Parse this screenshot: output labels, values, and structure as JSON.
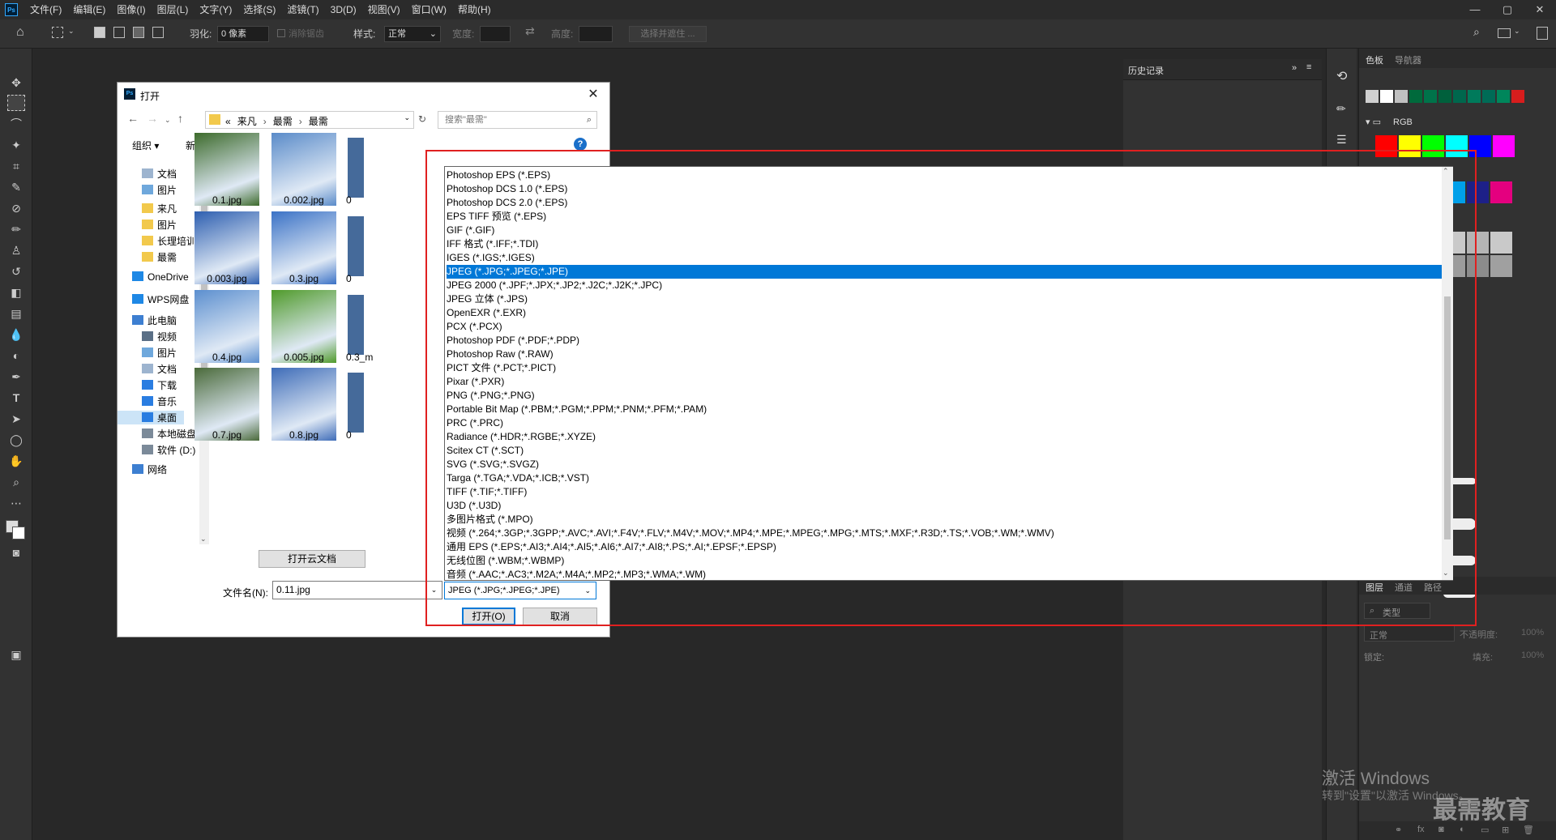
{
  "menubar": {
    "app_icon": "Ps",
    "items": [
      "文件(F)",
      "编辑(E)",
      "图像(I)",
      "图层(L)",
      "文字(Y)",
      "选择(S)",
      "滤镜(T)",
      "3D(D)",
      "视图(V)",
      "窗口(W)",
      "帮助(H)"
    ],
    "window_controls": [
      "—",
      "▢",
      "✕"
    ]
  },
  "options": {
    "feather_label": "羽化:",
    "feather_value": "0 像素",
    "antialias_label": "消除锯齿",
    "style_label": "样式:",
    "style_value": "正常",
    "width_label": "宽度:",
    "height_label": "高度:",
    "select_mask_label": "选择并遮住 ..."
  },
  "history_panel": {
    "title": "历史记录"
  },
  "swatches_panel": {
    "tabs": [
      "色板",
      "导航器"
    ],
    "group_label": "RGB",
    "recent_colors": [
      "#d0d0d0",
      "#ffffff",
      "#c0c0c0",
      "#006a3c",
      "#00734a",
      "#00603c",
      "#00674d",
      "#007a5b",
      "#006b56",
      "#00865b",
      "#d71d1d"
    ],
    "rgb_colors": [
      "#ff0000",
      "#ffff00",
      "#00ff00",
      "#00ffff",
      "#0000ff",
      "#ff00ff"
    ],
    "row2_colors": [
      "#00a0e9",
      "#1d2088",
      "#e4007f"
    ],
    "gray_colors": [
      "#c9c9c9",
      "#b5b5b5",
      "#c9c9c9",
      "#9c9c9c",
      "#8c8c8c",
      "#a0a0a0"
    ]
  },
  "layers_panel": {
    "tabs": [
      "图层",
      "通道",
      "路径"
    ],
    "kind_label": "类型",
    "blend_mode": "正常",
    "opacity_label": "不透明度:",
    "opacity_value": "100%",
    "lock_label": "锁定:",
    "fill_label": "填充:",
    "fill_value": "100%"
  },
  "dialog": {
    "title": "打开",
    "path": [
      "«",
      "来凡",
      "最需",
      "最需"
    ],
    "search_placeholder": "搜索\"最需\"",
    "organize": "组织 ▾",
    "new_folder": "新建文件夹",
    "nav_items": [
      {
        "label": "文档",
        "icon": "document-icon"
      },
      {
        "label": "图片",
        "icon": "picture-icon"
      },
      {
        "label": "来凡",
        "icon": "folder-icon"
      },
      {
        "label": "图片",
        "icon": "folder-icon"
      },
      {
        "label": "长理培训",
        "icon": "folder-icon"
      },
      {
        "label": "最需",
        "icon": "folder-icon"
      },
      {
        "label": "OneDrive",
        "icon": "cloud-icon"
      },
      {
        "label": "WPS网盘",
        "icon": "cloud-icon"
      },
      {
        "label": "此电脑",
        "icon": "computer-icon"
      },
      {
        "label": "视频",
        "icon": "video-icon"
      },
      {
        "label": "图片",
        "icon": "picture-icon"
      },
      {
        "label": "文档",
        "icon": "document-icon"
      },
      {
        "label": "下载",
        "icon": "download-icon"
      },
      {
        "label": "音乐",
        "icon": "music-icon"
      },
      {
        "label": "桌面",
        "icon": "desktop-icon"
      },
      {
        "label": "本地磁盘",
        "icon": "disk-icon"
      },
      {
        "label": "软件 (D:)",
        "icon": "disk-icon"
      },
      {
        "label": "网络",
        "icon": "network-icon"
      }
    ],
    "files": [
      {
        "name": "0.1.jpg",
        "color": "#3d6b2c"
      },
      {
        "name": "0.002.jpg",
        "color": "#5a8bc9"
      },
      {
        "name": "0.003.jpg",
        "color": "#2e5fb0"
      },
      {
        "name": "0.3.jpg",
        "color": "#3b72c6"
      },
      {
        "name": "0.4.jpg",
        "color": "#5c8fcf"
      },
      {
        "name": "0.005.jpg",
        "color": "#4f9a2a"
      },
      {
        "name": "0.7.jpg",
        "color": "#4a6a3a"
      },
      {
        "name": "0.8.jpg",
        "color": "#3e6cb8"
      }
    ],
    "partial_labels": [
      "0",
      "0",
      "0.3_m",
      "0"
    ],
    "open_cloud_doc": "打开云文档",
    "filename_label": "文件名(N):",
    "filename_value": "0.11.jpg",
    "filetype_selected": "JPEG (*.JPG;*.JPEG;*.JPE)",
    "open_button": "打开(O)",
    "cancel_button": "取消",
    "filetypes": [
      "Photoshop EPS (*.EPS)",
      "Photoshop DCS 1.0 (*.EPS)",
      "Photoshop DCS 2.0 (*.EPS)",
      "EPS TIFF 预览 (*.EPS)",
      "GIF (*.GIF)",
      "IFF 格式 (*.IFF;*.TDI)",
      "IGES (*.IGS;*.IGES)",
      "JPEG (*.JPG;*.JPEG;*.JPE)",
      "JPEG 2000 (*.JPF;*.JPX;*.JP2;*.J2C;*.J2K;*.JPC)",
      "JPEG 立体 (*.JPS)",
      "OpenEXR (*.EXR)",
      "PCX (*.PCX)",
      "Photoshop PDF (*.PDF;*.PDP)",
      "Photoshop Raw (*.RAW)",
      "PICT 文件 (*.PCT;*.PICT)",
      "Pixar (*.PXR)",
      "PNG (*.PNG;*.PNG)",
      "Portable Bit Map (*.PBM;*.PGM;*.PPM;*.PNM;*.PFM;*.PAM)",
      "PRC (*.PRC)",
      "Radiance (*.HDR;*.RGBE;*.XYZE)",
      "Scitex CT (*.SCT)",
      "SVG (*.SVG;*.SVGZ)",
      "Targa (*.TGA;*.VDA;*.ICB;*.VST)",
      "TIFF (*.TIF;*.TIFF)",
      "U3D (*.U3D)",
      "多图片格式 (*.MPO)",
      "视频 (*.264;*.3GP;*.3GPP;*.AVC;*.AVI;*.F4V;*.FLV;*.M4V;*.MOV;*.MP4;*.MPE;*.MPEG;*.MPG;*.MTS;*.MXF;*.R3D;*.TS;*.VOB;*.WM;*.WMV)",
      "通用 EPS (*.EPS;*.AI3;*.AI4;*.AI5;*.AI6;*.AI7;*.AI8;*.PS;*.AI;*.EPSF;*.EPSP)",
      "无线位图 (*.WBM;*.WBMP)",
      "音频 (*.AAC;*.AC3;*.M2A;*.M4A;*.MP2;*.MP3;*.WMA;*.WM)"
    ],
    "selected_filetype_index": 7
  },
  "watermark": {
    "activate": "激活 Windows",
    "activate_hint": "转到\"设置\"以激活 Windows。",
    "brand": "最需教育"
  }
}
